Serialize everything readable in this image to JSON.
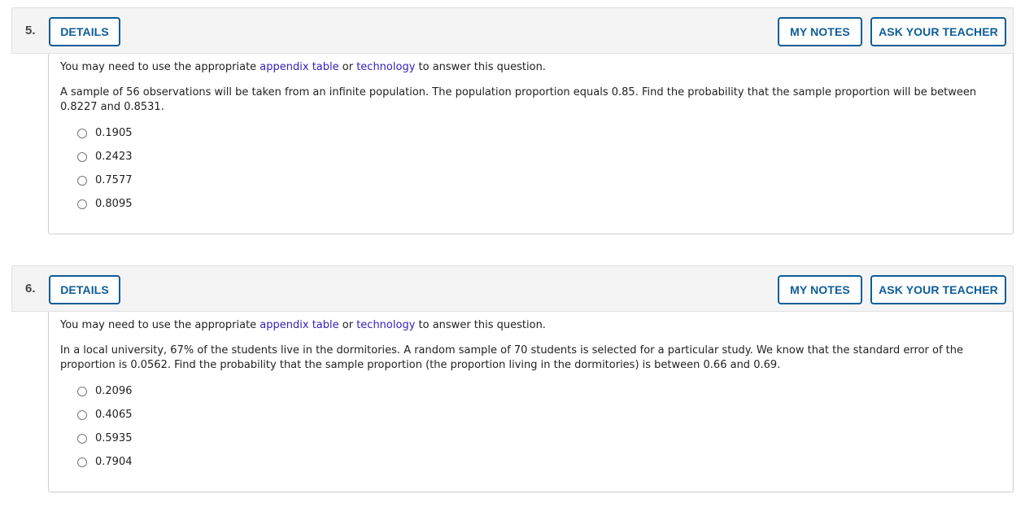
{
  "questions": [
    {
      "number": "5.",
      "details_label": "DETAILS",
      "my_notes_label": "MY NOTES",
      "ask_teacher_label": "ASK YOUR TEACHER",
      "intro": {
        "before": "You may need to use the appropriate ",
        "link1": "appendix table",
        "middle": " or ",
        "link2": "technology",
        "after": " to answer this question."
      },
      "prompt": "A sample of 56 observations will be taken from an infinite population. The population proportion equals 0.85. Find the probability that the sample proportion will be between 0.8227 and 0.8531.",
      "options": [
        "0.1905",
        "0.2423",
        "0.7577",
        "0.8095"
      ]
    },
    {
      "number": "6.",
      "details_label": "DETAILS",
      "my_notes_label": "MY NOTES",
      "ask_teacher_label": "ASK YOUR TEACHER",
      "intro": {
        "before": "You may need to use the appropriate ",
        "link1": "appendix table",
        "middle": " or ",
        "link2": "technology",
        "after": " to answer this question."
      },
      "prompt": "In a local university, 67% of the students live in the dormitories. A random sample of 70 students is selected for a particular study. We know that the standard error of the proportion is 0.0562. Find the probability that the sample proportion (the proportion living in the dormitories) is between 0.66 and 0.69.",
      "options": [
        "0.2096",
        "0.4065",
        "0.5935",
        "0.7904"
      ]
    }
  ],
  "colors": {
    "accent": "#0d5d99",
    "link": "#3322bb",
    "header_bg": "#f4f4f4"
  }
}
